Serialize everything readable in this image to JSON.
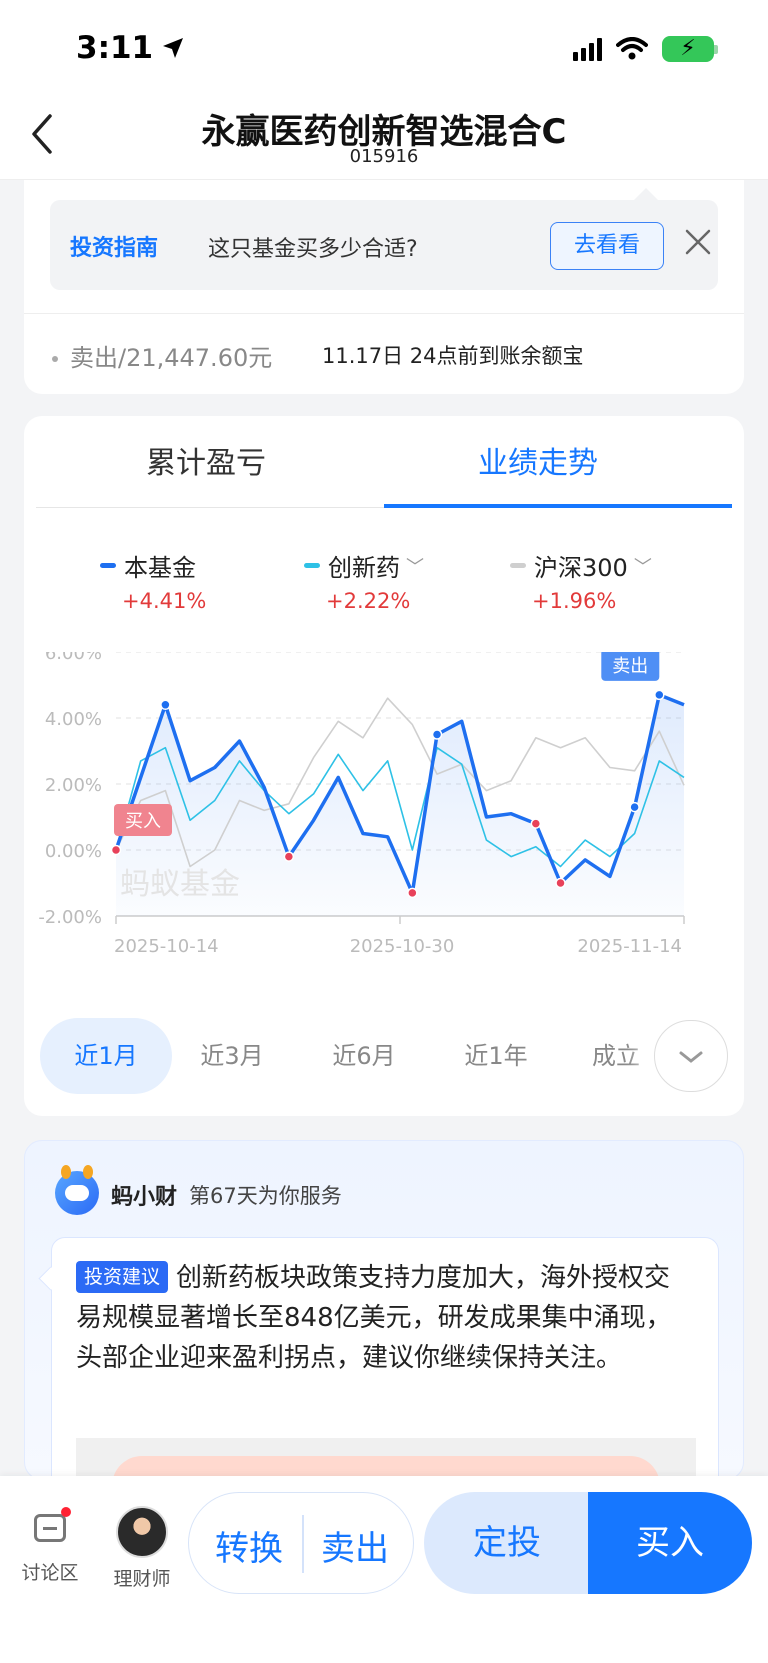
{
  "status": {
    "time": "3:11",
    "battery_icon": "⚡"
  },
  "nav": {
    "title": "永赢医药创新智选混合C",
    "code": "015916"
  },
  "guide": {
    "tag": "投资指南",
    "question": "这只基金买多少合适?",
    "button": "去看看"
  },
  "transaction": {
    "sold": "卖出/21,447.60元",
    "arrival": "11.17日 24点前到账余额宝"
  },
  "tabs": [
    {
      "label": "累计盈亏",
      "selected": false
    },
    {
      "label": "业绩走势",
      "selected": true
    }
  ],
  "legend": [
    {
      "name": "本基金",
      "value": "+4.41%",
      "color": "#1e6ff0"
    },
    {
      "name": "创新药",
      "value": "+2.22%",
      "color": "#2ec1e6"
    },
    {
      "name": "沪深300",
      "value": "+1.96%",
      "color": "#cfcfcf"
    }
  ],
  "chart_data": {
    "type": "line",
    "y_tick_labels": [
      "6.00%",
      "4.00%",
      "2.00%",
      "0.00%",
      "-2.00%"
    ],
    "ylim": [
      -2,
      6
    ],
    "x_tick_labels": [
      "2025-10-14",
      "2025-10-30",
      "2025-11-14"
    ],
    "watermark": "蚂蚁基金",
    "buy_label": "买入",
    "sell_label": "卖出",
    "series": [
      {
        "name": "本基金",
        "color": "#1e6ff0",
        "values": [
          0.0,
          2.2,
          4.4,
          2.1,
          2.5,
          3.3,
          1.9,
          -0.2,
          0.9,
          2.2,
          0.5,
          0.4,
          -1.3,
          3.5,
          3.9,
          1.0,
          1.1,
          0.8,
          -1.0,
          -0.3,
          -0.8,
          1.3,
          4.7,
          4.4
        ]
      },
      {
        "name": "创新药",
        "color": "#2ec1e6",
        "values": [
          0.0,
          2.7,
          3.1,
          0.9,
          1.5,
          2.7,
          1.8,
          1.1,
          1.7,
          2.9,
          1.8,
          2.7,
          0.0,
          3.1,
          2.6,
          0.3,
          -0.2,
          0.1,
          -0.5,
          0.3,
          -0.2,
          0.5,
          2.7,
          2.2
        ]
      },
      {
        "name": "沪深300",
        "color": "#cfcfcf",
        "values": [
          0.0,
          1.5,
          1.8,
          -0.5,
          0.0,
          1.5,
          1.2,
          1.4,
          2.8,
          3.9,
          3.4,
          4.6,
          3.8,
          2.3,
          2.6,
          1.8,
          2.1,
          3.4,
          3.1,
          3.4,
          2.5,
          2.4,
          3.6,
          1.96
        ]
      }
    ],
    "markers": [
      {
        "index": 0,
        "kind": "buy"
      },
      {
        "index": 2,
        "kind": "point"
      },
      {
        "index": 7,
        "kind": "buy"
      },
      {
        "index": 12,
        "kind": "buy"
      },
      {
        "index": 13,
        "kind": "point"
      },
      {
        "index": 17,
        "kind": "buy"
      },
      {
        "index": 18,
        "kind": "buy"
      },
      {
        "index": 21,
        "kind": "point"
      },
      {
        "index": 22,
        "kind": "point"
      }
    ]
  },
  "ranges": [
    {
      "label": "近1月",
      "selected": true
    },
    {
      "label": "近3月",
      "selected": false
    },
    {
      "label": "近6月",
      "selected": false
    },
    {
      "label": "近1年",
      "selected": false
    },
    {
      "label": "成立",
      "selected": false
    }
  ],
  "advisor": {
    "name": "蚂小财",
    "days": "第67天为你服务",
    "tag": "投资建议",
    "text": "创新药板块政策支持力度加大，海外授权交易规模显著增长至848亿美元，研发成果集中涌现，头部企业迎来盈利拐点，建议你继续保持关注。"
  },
  "bottom": {
    "discuss": "讨论区",
    "advisor": "理财师",
    "convert": "转换",
    "sell": "卖出",
    "auto_invest": "定投",
    "buy": "买入"
  }
}
